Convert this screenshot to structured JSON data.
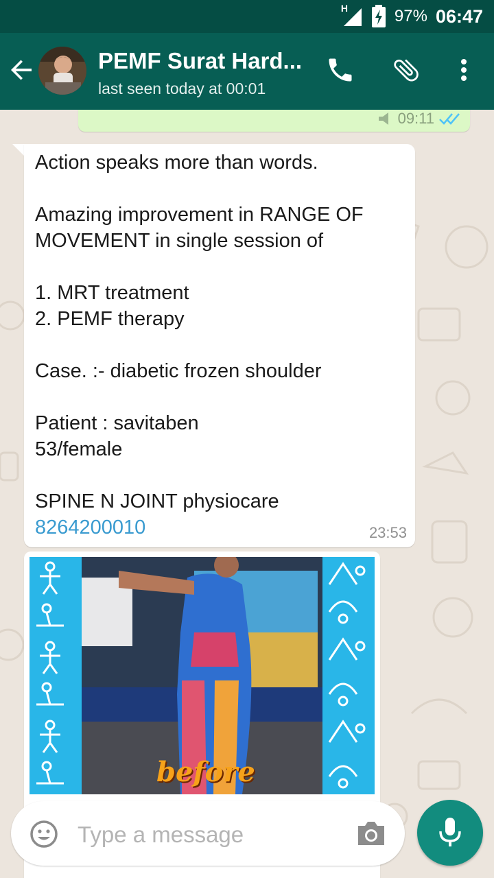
{
  "status_bar": {
    "network": "H",
    "battery": "97%",
    "time": "06:47"
  },
  "header": {
    "contact_name": "PEMF Surat Hard...",
    "last_seen": "last seen today at 00:01",
    "icons": [
      "back-arrow-icon",
      "phone-icon",
      "attach-icon",
      "more-icon"
    ]
  },
  "messages": {
    "outgoing_partial": {
      "time": "09:11",
      "status": "read"
    },
    "incoming_text": {
      "text": "Action speaks more than words.\n\nAmazing improvement in RANGE OF MOVEMENT in single session of\n\n1. MRT treatment\n2. PEMF therapy\n\nCase. :- diabetic frozen shoulder\n\nPatient : savitaben\n53/female\n\nSPINE N JOINT physiocare",
      "phone_link": "8264200010",
      "time": "23:53"
    },
    "incoming_image": {
      "overlay_text": "before"
    }
  },
  "composer": {
    "placeholder": "Type a message"
  },
  "colors": {
    "header": "#075e54",
    "status_bar": "#054d44",
    "outgoing_bubble": "#dcf8c6",
    "fab": "#128c7e",
    "link": "#3a9bd0",
    "read_ticks": "#4fc3f7"
  }
}
